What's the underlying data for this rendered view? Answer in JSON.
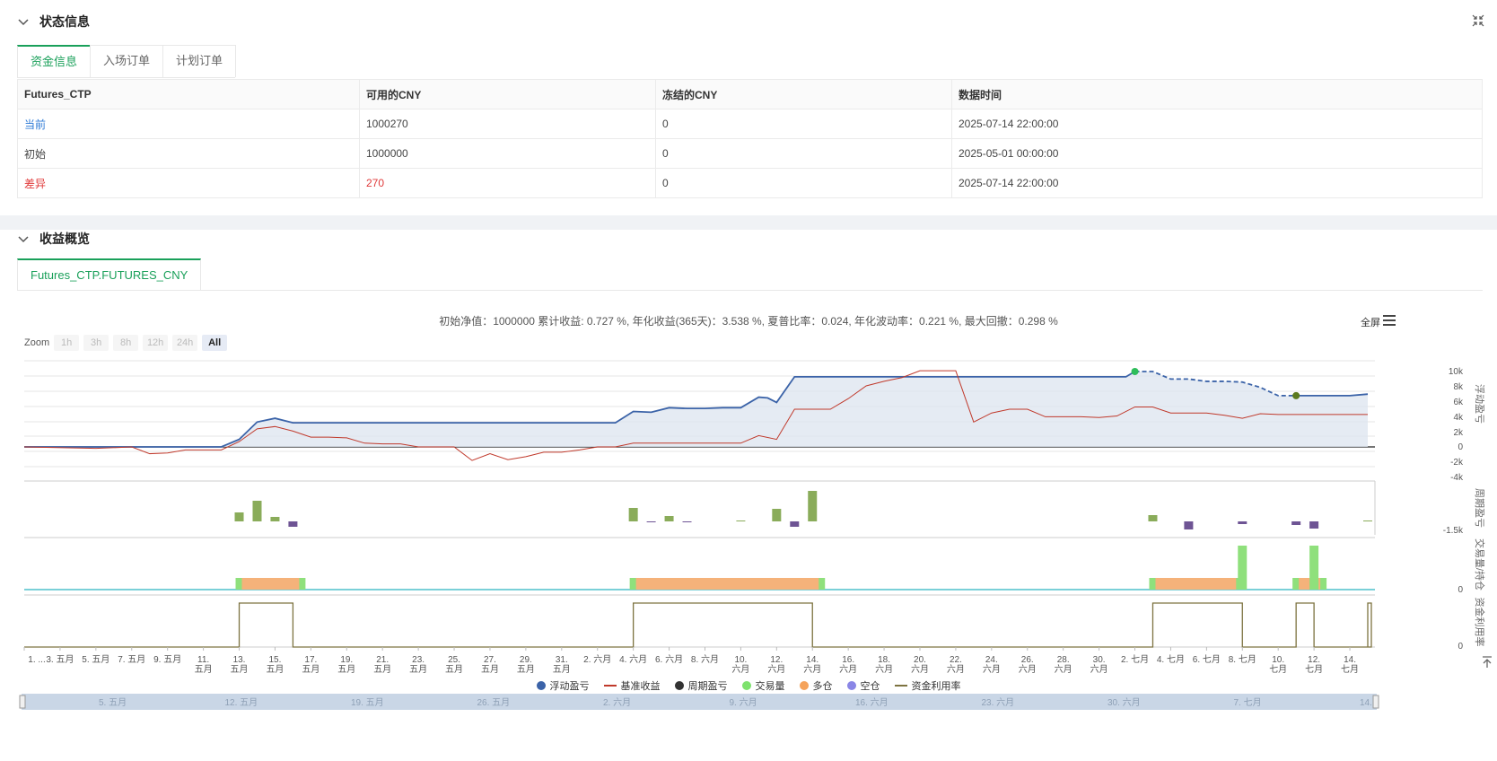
{
  "status": {
    "title": "状态信息",
    "tabs": [
      "资金信息",
      "入场订单",
      "计划订单"
    ],
    "table": {
      "headers": [
        "Futures_CTP",
        "可用的CNY",
        "冻结的CNY",
        "数据时间"
      ],
      "rows": [
        [
          "当前",
          "1000270",
          "0",
          "2025-07-14 22:00:00"
        ],
        [
          "初始",
          "1000000",
          "0",
          "2025-05-01 00:00:00"
        ],
        [
          "差异",
          "270",
          "0",
          "2025-07-14 22:00:00"
        ]
      ]
    }
  },
  "overview": {
    "title": "收益概览",
    "tab": "Futures_CTP.FUTURES_CNY",
    "summary": "初始净值：1000000 累计收益: 0.727 %, 年化收益(365天)：3.538 %, 夏普比率：0.024, 年化波动率：0.221 %, 最大回撤：0.298 %",
    "fullscreen": "全屏",
    "zoom_label": "Zoom",
    "zoom_buttons": [
      "1h",
      "3h",
      "8h",
      "12h",
      "24h",
      "All"
    ],
    "panel_titles": [
      "浮动盈亏",
      "周期盈亏",
      "交易量/持仓",
      "资金利用率"
    ],
    "y_ticks": [
      "10k",
      "8k",
      "6k",
      "4k",
      "2k",
      "0",
      "-2k",
      "-4k"
    ],
    "bar_tick": "-1.5k",
    "zero": "0",
    "x_ticks_line1": [
      "1. ...",
      "3. 五月",
      "5. 五月",
      "7. 五月",
      "9. 五月",
      "11.",
      "13.",
      "15.",
      "17.",
      "19.",
      "21.",
      "23.",
      "25.",
      "27.",
      "29.",
      "31.",
      "2. 六月",
      "4. 六月",
      "6. 六月",
      "8. 六月",
      "10.",
      "12.",
      "14.",
      "16.",
      "18.",
      "20.",
      "22.",
      "24.",
      "26.",
      "28.",
      "30.",
      "2. 七月",
      "4. 七月",
      "6. 七月",
      "8. 七月",
      "10.",
      "12.",
      "14."
    ],
    "x_ticks_line2": [
      "",
      "",
      "",
      "",
      "",
      "五月",
      "五月",
      "五月",
      "五月",
      "五月",
      "五月",
      "五月",
      "五月",
      "五月",
      "五月",
      "五月",
      "",
      "",
      "",
      "",
      "六月",
      "六月",
      "六月",
      "六月",
      "六月",
      "六月",
      "六月",
      "六月",
      "六月",
      "六月",
      "六月",
      "",
      "",
      "",
      "",
      "七月",
      "七月",
      "七月"
    ],
    "legend": [
      {
        "label": "浮动盈亏",
        "color": "#3b63a8",
        "kind": "dot"
      },
      {
        "label": "基准收益",
        "color": "#c0392b",
        "kind": "line"
      },
      {
        "label": "周期盈亏",
        "color": "#333333",
        "kind": "dot"
      },
      {
        "label": "交易量",
        "color": "#7ee26e",
        "kind": "dot"
      },
      {
        "label": "多仓",
        "color": "#f5a35b",
        "kind": "dot"
      },
      {
        "label": "空仓",
        "color": "#8a86e6",
        "kind": "dot"
      },
      {
        "label": "资金利用率",
        "color": "#7d7340",
        "kind": "line"
      }
    ],
    "navigator_ticks": [
      "5. 五月",
      "12. 五月",
      "19. 五月",
      "26. 五月",
      "2. 六月",
      "9. 六月",
      "16. 六月",
      "23. 六月",
      "30. 六月",
      "7. 七月",
      "14."
    ]
  },
  "chart_data": {
    "type": "line",
    "x_unit": "days since 1 五月 (2025-05-01)",
    "ylim": [
      -5000,
      11000
    ],
    "series": [
      {
        "name": "浮动盈亏",
        "color": "#3b63a8",
        "x": [
          0,
          11,
          12,
          13,
          14,
          15,
          33,
          34,
          35,
          36,
          37,
          38,
          39,
          40,
          41,
          41.5,
          42,
          43,
          44,
          45,
          61.5,
          62,
          63,
          64,
          65,
          66,
          67,
          68,
          69,
          70,
          71,
          72,
          73,
          74,
          75
        ],
        "y": [
          0,
          0,
          1000,
          3300,
          3800,
          3200,
          3200,
          4700,
          4600,
          5200,
          5100,
          5100,
          5200,
          5200,
          6600,
          6500,
          5900,
          9300,
          9300,
          9300,
          9300,
          10000,
          10000,
          9000,
          9000,
          8700,
          8700,
          8600,
          7900,
          6800,
          6800,
          6800,
          6800,
          6800,
          7000
        ]
      },
      {
        "name": "基准收益",
        "color": "#c0392b",
        "x": [
          0,
          4,
          6,
          7,
          8,
          9,
          11,
          12,
          13,
          14,
          15,
          16,
          17,
          18,
          19,
          20,
          21,
          22,
          23,
          24,
          25,
          26,
          27,
          28,
          29,
          30,
          31,
          32,
          33,
          34,
          35,
          36,
          37,
          38,
          39,
          40,
          41,
          42,
          43,
          44,
          45,
          46,
          47,
          48,
          49,
          50,
          51,
          52,
          53,
          54,
          55,
          56,
          57,
          58,
          59,
          60,
          61,
          62,
          63,
          64,
          65,
          66,
          67,
          68,
          69,
          70,
          71,
          72,
          73,
          74,
          75
        ],
        "y": [
          0,
          -200,
          0,
          -900,
          -800,
          -400,
          -400,
          700,
          2400,
          2700,
          2100,
          1300,
          1300,
          1200,
          500,
          400,
          400,
          0,
          0,
          0,
          -1800,
          -900,
          -1700,
          -1300,
          -700,
          -700,
          -400,
          0,
          0,
          500,
          500,
          500,
          500,
          500,
          500,
          500,
          1500,
          1000,
          5000,
          5000,
          5000,
          6400,
          8100,
          8700,
          9200,
          10100,
          10100,
          10100,
          3300,
          4500,
          5000,
          5000,
          4000,
          4000,
          4000,
          3900,
          4100,
          5300,
          5300,
          4500,
          4500,
          4500,
          4200,
          3800,
          4400,
          4300,
          4300,
          4300,
          4300,
          4300,
          4300
        ]
      }
    ],
    "bars": [
      {
        "x": 12,
        "y": 1000
      },
      {
        "x": 13,
        "y": 2300
      },
      {
        "x": 14,
        "y": 500
      },
      {
        "x": 15,
        "y": -600
      },
      {
        "x": 34,
        "y": 1500
      },
      {
        "x": 35,
        "y": -100
      },
      {
        "x": 36,
        "y": 600
      },
      {
        "x": 37,
        "y": -50
      },
      {
        "x": 40,
        "y": 100
      },
      {
        "x": 42,
        "y": 1400
      },
      {
        "x": 43,
        "y": -600
      },
      {
        "x": 44,
        "y": 3400
      },
      {
        "x": 63,
        "y": 700
      },
      {
        "x": 65,
        "y": -900
      },
      {
        "x": 68,
        "y": -300
      },
      {
        "x": 71,
        "y": -400
      },
      {
        "x": 72,
        "y": -800
      },
      {
        "x": 75,
        "y": 100
      }
    ],
    "positions": [
      {
        "from": 12,
        "to": 15.5,
        "label": "多仓"
      },
      {
        "from": 34,
        "to": 44.5,
        "label": "多仓"
      },
      {
        "from": 63,
        "to": 67.8,
        "label": "多仓"
      },
      {
        "from": 71,
        "to": 72.5,
        "label": "多仓"
      }
    ],
    "volume": [
      {
        "x": 68,
        "y": 1
      },
      {
        "x": 72,
        "y": 1
      }
    ],
    "utilization": [
      {
        "from": 12,
        "to": 15
      },
      {
        "from": 34,
        "to": 44
      },
      {
        "from": 63,
        "to": 68
      },
      {
        "from": 71,
        "to": 72
      },
      {
        "from": 75,
        "to": 75.2
      }
    ]
  }
}
